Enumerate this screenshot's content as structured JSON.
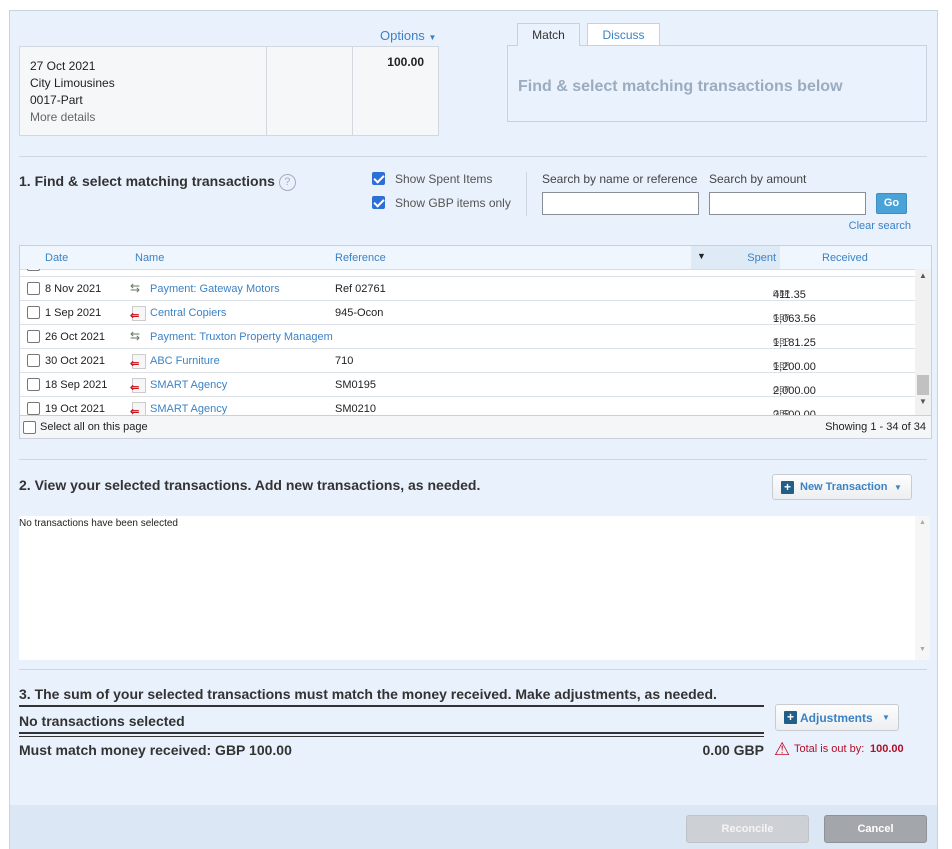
{
  "statement": {
    "date": "27 Oct 2021",
    "payee": "City Limousines",
    "reference": "0017-Part",
    "more_details": "More details",
    "amount": "100.00",
    "options_label": "Options"
  },
  "tabs": [
    {
      "label": "Match",
      "active": true
    },
    {
      "label": "Discuss",
      "active": false
    }
  ],
  "match_panel": {
    "message": "Find & select matching transactions below"
  },
  "section1": {
    "title": "1. Find & select matching transactions",
    "show_spent": {
      "label": "Show Spent Items",
      "checked": true
    },
    "show_gbp": {
      "label": "Show GBP items only",
      "checked": true
    },
    "search_name_label": "Search by name or reference",
    "search_name_value": "",
    "search_amount_label": "Search by amount",
    "search_amount_value": "",
    "go_label": "Go",
    "clear_label": "Clear search"
  },
  "table": {
    "headers": {
      "date": "Date",
      "name": "Name",
      "reference": "Reference",
      "spent": "Spent",
      "received": "Received"
    },
    "rows": [
      {
        "date": "8 Nov 2021",
        "icon": "transfer-icon",
        "name": "Payment: Gateway Motors",
        "reference": "Ref 02761",
        "spent": "411.35",
        "currency": "GBP"
      },
      {
        "date": "1 Sep 2021",
        "icon": "bill-icon",
        "name": "Central Copiers",
        "reference": "945-Ocon",
        "spent": "1,063.56",
        "currency": "GBP"
      },
      {
        "date": "26 Oct 2021",
        "icon": "transfer-icon",
        "name": "Payment: Truxton Property Managem",
        "reference": "",
        "spent": "1,181.25",
        "currency": "GBP"
      },
      {
        "date": "30 Oct 2021",
        "icon": "bill-icon",
        "name": "ABC Furniture",
        "reference": "710",
        "spent": "1,200.00",
        "currency": "GBP"
      },
      {
        "date": "18 Sep 2021",
        "icon": "bill-icon",
        "name": "SMART Agency",
        "reference": "SM0195",
        "spent": "2,000.00",
        "currency": "GBP"
      },
      {
        "date": "19 Oct 2021",
        "icon": "bill-icon",
        "name": "SMART Agency",
        "reference": "SM0210",
        "spent": "2,500.00",
        "currency": "GBP"
      }
    ],
    "select_all": "Select all on this page",
    "showing": "Showing 1 - 34 of 34"
  },
  "section2": {
    "title": "2. View your selected transactions. Add new transactions, as needed.",
    "new_transaction": "New Transaction",
    "empty": "No transactions have been selected"
  },
  "section3": {
    "title": "3. The sum of your selected transactions must match the money received. Make adjustments, as needed.",
    "none_selected": "No transactions selected",
    "must_match": "Must match money received: GBP 100.00",
    "total": "0.00 GBP",
    "adjustments": "Adjustments",
    "out_by_label": "Total is out by:",
    "out_by_value": "100.00"
  },
  "footer": {
    "reconcile": "Reconcile",
    "cancel": "Cancel"
  },
  "colors": {
    "link": "#3c82c4",
    "error": "#b0102a",
    "go": "#4aa3d8"
  }
}
